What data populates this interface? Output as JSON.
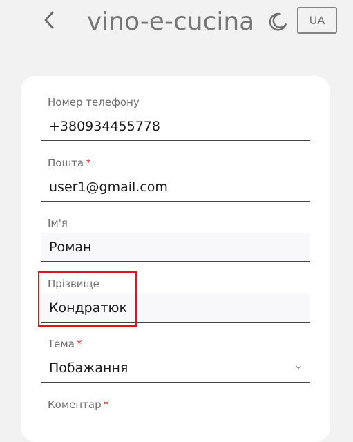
{
  "header": {
    "title": "vino-e-cucina",
    "language_button": "UA",
    "back_icon": "chevron-left-icon",
    "theme_icon": "moon-icon"
  },
  "form": {
    "phone": {
      "label": "Номер телефону",
      "value": "+380934455778"
    },
    "email": {
      "label": "Пошта",
      "required_mark": "*",
      "value": "user1@gmail.com"
    },
    "first_name": {
      "label": "Ім'я",
      "value": "Роман"
    },
    "last_name": {
      "label": "Прізвище",
      "value": "Кондратюк"
    },
    "topic": {
      "label": "Тема",
      "required_mark": "*",
      "value": "Побажання",
      "icon": "chevron-down-icon"
    },
    "comment": {
      "label": "Коментар",
      "required_mark": "*"
    }
  },
  "colors": {
    "background": "#f2f2f2",
    "card": "#ffffff",
    "required": "#d01f1f",
    "highlight": "#e0141a"
  }
}
